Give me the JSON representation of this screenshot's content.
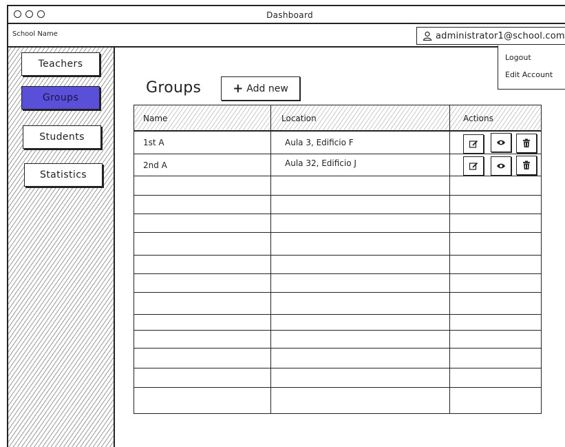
{
  "window": {
    "title": "Dashboard"
  },
  "header": {
    "school_name": "School Name",
    "user_email": "administrator1@school.com",
    "user_icon": "user-icon"
  },
  "user_menu": {
    "items": [
      "Logout",
      "Edit Account"
    ]
  },
  "sidebar": {
    "items": [
      {
        "label": "Teachers",
        "active": false
      },
      {
        "label": "Groups",
        "active": true
      },
      {
        "label": "Students",
        "active": false
      },
      {
        "label": "Statistics",
        "active": false
      }
    ]
  },
  "main": {
    "title": "Groups",
    "add_button": {
      "label": "Add new",
      "icon": "plus-icon"
    }
  },
  "table": {
    "columns": [
      "Name",
      "Location",
      "Actions"
    ],
    "rows": [
      {
        "name": "1st A",
        "location": "Aula 3, Edificio F"
      },
      {
        "name": "2nd A",
        "location": "Aula 32, Edificio J"
      }
    ],
    "row_actions": [
      "edit-icon",
      "view-icon",
      "delete-icon"
    ]
  },
  "colors": {
    "active_nav": "#5a4fd8",
    "border": "#222222"
  }
}
